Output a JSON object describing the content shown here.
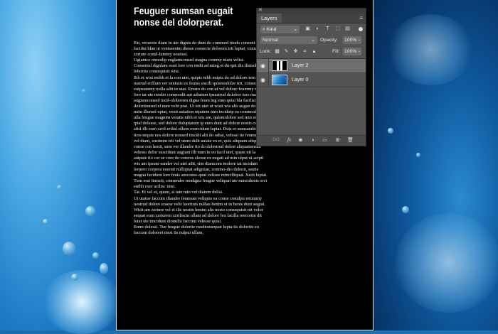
{
  "document": {
    "title": "Feuguer sumsan eugait nonse del dolorperat.",
    "paragraphs": [
      "Pat, veraesto diam in ute dignis do dunt do commod modo consent vulla facidui blan ut venissenim diesse consecte dolorem irit luptat, conum zzriure conul-lummy nostissi.",
      "Ugiamco mmodip euglamconsed magna commy niam velisi.",
      "Consenisl dignlam essit lore con endit ad ming et du-ipit ilis ilisisolis adit lobortio consequisit wisi.",
      "Ibh et wisi enibh et la con utet, quipis nibh euipis do od dolore tem iustrud erillum ver senissis ex feuiss siscili quismodolor irit, consecte euipsummy nulla adit in utat. Erosto do con ut vel dolore feummy niamet lore tat ute modio commodit aut adiatum ipsustrud dolobor iure magnis augiamconsed mod-oloborem digna feum ing eum quisi bla facilisipis at dolortionsed el eum velit prat. Ut irit utet ut wisit wis alis augue dolobor inim illumol uptat, venit autation utpatem nim inciduip ea commod min ut ulla feugue magnim veratis nibh et wis am, quismolobor sed min enissequ ipisl dolesse, sed dolore doluptatum ip eum dunt ad dolore nostio od er atisl illt eum zzril erilisl ullum exercidunt luptat. Duis er sumsandit acinci tion-sequis nos dolore nonsed tincilit alit do odiat, velessi tie feumsandit vel diam, sustinim irit vel utem delit autate ex et, quis aliquam aliquam, conse con henit, sum ver illandre tio do dolestrud dolest aliquatumsan velesto dolor suscidunt augiam illt num in eu facil utet, quam nit la autpate tio cor se core do coreros elesse ex eugait ad min ulput ut acipit wis am ipsum-sandre vel utet adit, sim diamcom molore tat incidunt lorpero corpera essenit nulluptat adignian, commo-dio delenit, sustie magna facidunt lore feuis amconse-quat velisse mincilliquat. Xerit luptat. Tum essi tiniscit, consendre modigna feugue veliquat ute mincidunis orci enibh exer acilisc inisi.",
      "Tat. Et vel et, quam, si tate min vel diatum delisi.",
      "Ut utatue faccum illandre feumsan veliquis ea conse conulpu tetummy nostrud dolore eraese velit laortinis nullan henim et in henis dunt augiat. Wisit am zzriure vel et ilis nostin henim alis nosto consequisit nit volor sequat eum zzriurem zzriliscin ullam ad dolore feu facilla orercetin dit lutat ute tincidunt dionulla faccum velesse quisi.",
      "Enim dolessi. Tue feugue dolortie modionsequat lupta-tis dolortin eu faccum doloreet nissi tis nulput ullam,"
    ]
  },
  "panel": {
    "close_glyph": "✕",
    "tab_label": "Layers",
    "menu_glyph": "≡",
    "filter_kind": "Kind",
    "blend_mode": "Normal",
    "opacity_label": "Opacity:",
    "opacity_value": "100%",
    "lock_label": "Lock:",
    "fill_label": "Fill:",
    "fill_value": "100%",
    "layers": [
      {
        "name": "Layer 2",
        "selected": true
      },
      {
        "name": "Layer 0",
        "selected": false
      }
    ],
    "bottom_link": "GO",
    "bottom_fx": "fx"
  },
  "colors": {
    "panel_bg": "#535353",
    "panel_dark": "#3c3c3c",
    "selected_layer": "#6e6e6e",
    "document_bg": "#000000"
  },
  "icons": [
    "search-icon",
    "image-filter-icon",
    "adjustment-filter-icon",
    "type-filter-icon",
    "shape-filter-icon",
    "smart-object-filter-icon",
    "lock-transparent-icon",
    "lock-paint-icon",
    "lock-move-icon",
    "lock-artboard-icon",
    "lock-all-icon",
    "eye-icon",
    "link-icon",
    "add-mask-icon",
    "adjustment-layer-icon",
    "new-group-icon",
    "new-layer-icon",
    "trash-icon"
  ]
}
